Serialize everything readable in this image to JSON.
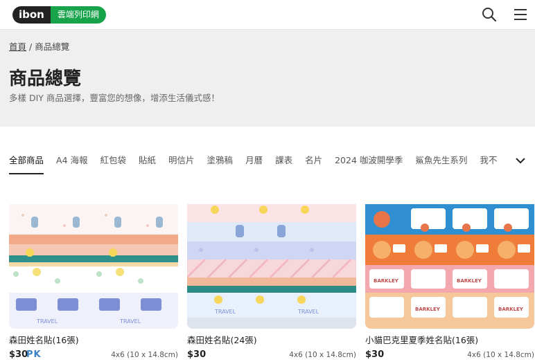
{
  "brand": {
    "logo_text": "ibon",
    "tag": "雲端列印網"
  },
  "breadcrumb": {
    "home": "首頁",
    "separator": "/",
    "current": "商品總覽"
  },
  "hero": {
    "title": "商品總覽",
    "subtitle": "多樣 DIY 商品選擇，豐富您的想像，增添生活儀式感！"
  },
  "tabs": [
    {
      "label": "全部商品",
      "active": true
    },
    {
      "label": "A4 海報"
    },
    {
      "label": "紅包袋"
    },
    {
      "label": "貼紙"
    },
    {
      "label": "明信片"
    },
    {
      "label": "塗鴉稿"
    },
    {
      "label": "月曆"
    },
    {
      "label": "課表"
    },
    {
      "label": "名片"
    },
    {
      "label": "2024 咖波開學季"
    },
    {
      "label": "鯊魚先生系列"
    },
    {
      "label": "我不"
    }
  ],
  "products": [
    {
      "title": "森田姓名貼(16張)",
      "price": "$30",
      "size": "4x6 (10 x 14.8cm)"
    },
    {
      "title": "森田姓名貼(24張)",
      "price": "$30",
      "size": "4x6 (10 x 14.8cm)"
    },
    {
      "title": "小貓巴克里夏季姓名貼(16張)",
      "price": "$30",
      "size": "4x6 (10 x 14.8cm)"
    }
  ],
  "thumb_labels": {
    "travel": "TRAVEL",
    "barkley": "BARKLEY"
  },
  "watermark": "PK",
  "colors": {
    "brand_green": "#16a34a",
    "logo_dark": "#222222"
  },
  "icons": {
    "search": "search-icon",
    "menu": "menu-icon",
    "more_tabs": "chevron-down-icon"
  }
}
